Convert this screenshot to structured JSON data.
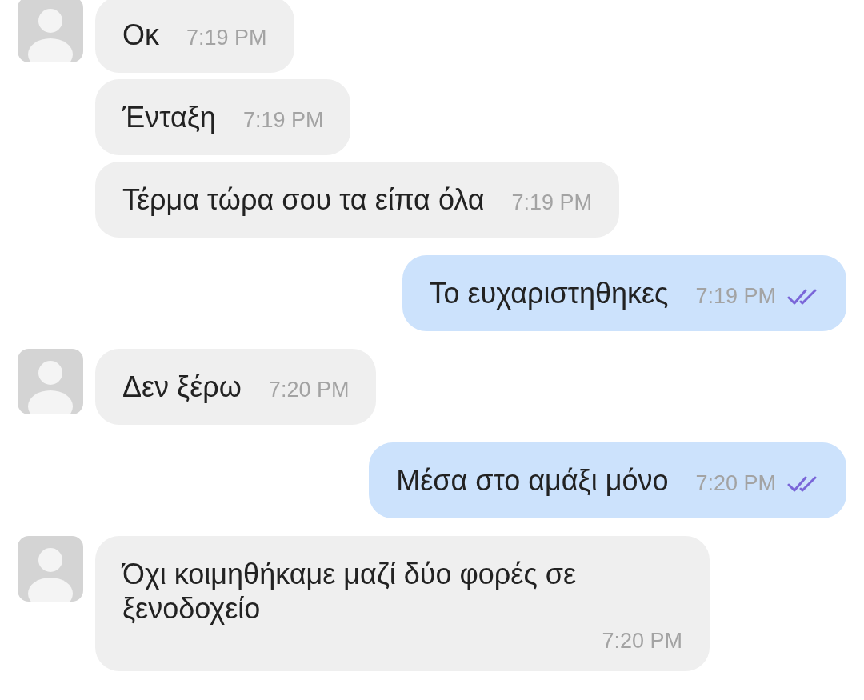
{
  "messages": [
    {
      "outgoing": false,
      "avatar": true,
      "kind": "inline",
      "text": "Οκ",
      "time": "7:19 PM"
    },
    {
      "outgoing": false,
      "avatar": false,
      "kind": "inline",
      "text": "Ένταξη",
      "time": "7:19 PM"
    },
    {
      "outgoing": false,
      "avatar": false,
      "kind": "inline",
      "text": "Τέρμα τώρα σου τα είπα όλα",
      "time": "7:19 PM"
    },
    {
      "outgoing": true,
      "kind": "inline",
      "text": "Το ευχαριστηθηκες",
      "time": "7:19 PM",
      "read": true
    },
    {
      "outgoing": false,
      "avatar": true,
      "kind": "inline",
      "text": "Δεν ξέρω",
      "time": "7:20 PM"
    },
    {
      "outgoing": true,
      "kind": "inline",
      "text": "Μέσα στο αμάξι μόνο",
      "time": "7:20 PM",
      "read": true
    },
    {
      "outgoing": false,
      "avatar": true,
      "kind": "stacked",
      "text": "Όχι κοιμηθήκαμε μαζί δύο φορές σε ξενοδοχείο",
      "time": "7:20 PM"
    }
  ]
}
